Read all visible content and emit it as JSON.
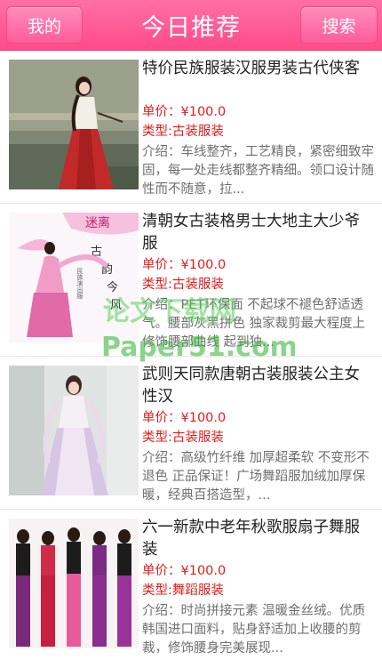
{
  "header": {
    "left_button": "我的",
    "title": "今日推荐",
    "right_button": "搜索"
  },
  "labels": {
    "price_prefix": "单价：",
    "type_prefix": "类型:",
    "desc_prefix": "介绍："
  },
  "items": [
    {
      "title": "特价民族服装汉服男装古代侠客",
      "price": "¥100.0",
      "type": "古装服装",
      "desc": "车线整齐，工艺精良，紧密细致牢固，每一处走线都整齐精细。领口设计随性而不随意，拉..."
    },
    {
      "title": "清朝女古装格男士大地主大少爷服",
      "price": "¥100.0",
      "type": "古装服装",
      "desc": "PET环保面 不起球不褪色舒适透气。腰部灰黑拼色 独家裁剪最大程度上修饰腰部曲线 起到独..."
    },
    {
      "title": "武则天同款唐朝古装服装公主女性汉",
      "price": "¥100.0",
      "type": "古装服装",
      "desc": "高级竹纤维 加厚超柔软 不变形不退色 正品保证！广场舞蹈服加绒加厚保暖，经典百搭造型，..."
    },
    {
      "title": "六一新款中老年秋歌服扇子舞服装",
      "price": "¥100.0",
      "type": "舞蹈服装",
      "desc": "时尚拼接元素 温暖金丝绒。优质韩国进口面料，贴身舒适加上收腰的剪裁，修饰腰身完美展现..."
    }
  ],
  "thumb2_text": [
    "迷离",
    "古",
    "韵",
    "今",
    "风",
    "民族演出服"
  ],
  "watermark": {
    "line1": "论文下载网",
    "line2": "Paper51.com"
  },
  "colors": {
    "accent": "#ff5d98",
    "price": "#e31b1b",
    "watermark": "#4cc94c"
  }
}
